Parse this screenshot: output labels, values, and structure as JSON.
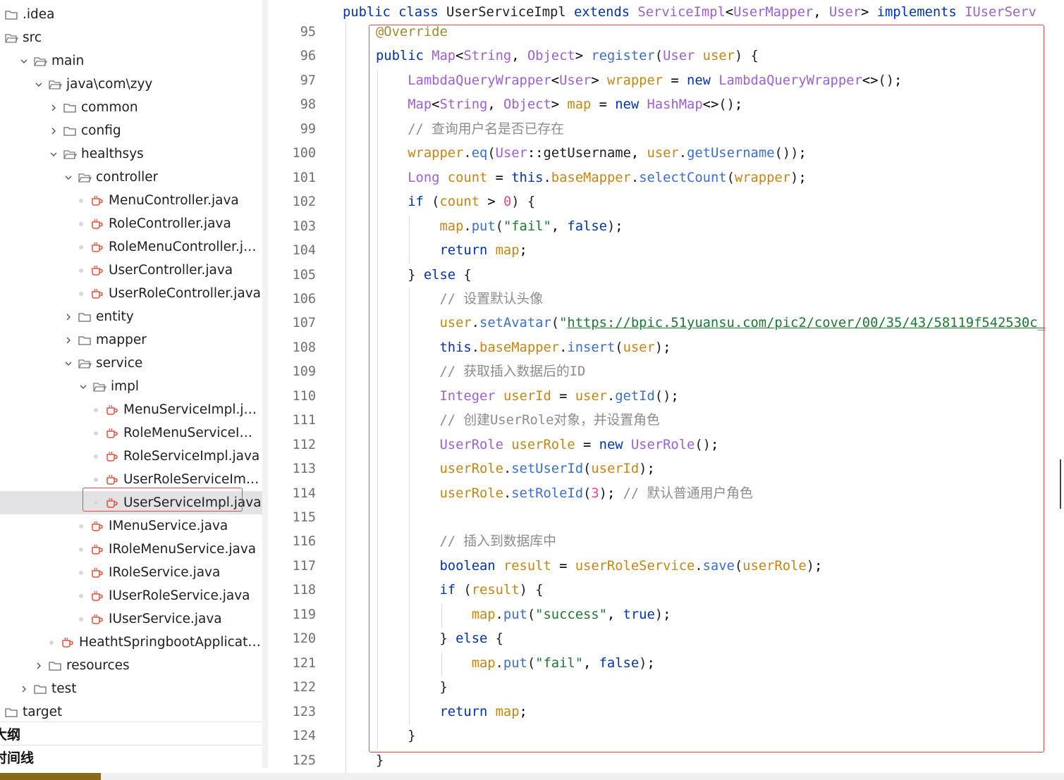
{
  "explorer": {
    "items": [
      {
        "label": ".idea",
        "type": "folder",
        "depth": 0,
        "chevron": "none"
      },
      {
        "label": "src",
        "type": "folder-open",
        "depth": 0,
        "chevron": "none"
      },
      {
        "label": "main",
        "type": "folder-open",
        "depth": 1,
        "chevron": "down"
      },
      {
        "label": "java\\com\\zyy",
        "type": "folder-open",
        "depth": 2,
        "chevron": "down"
      },
      {
        "label": "common",
        "type": "folder",
        "depth": 3,
        "chevron": "right"
      },
      {
        "label": "config",
        "type": "folder",
        "depth": 3,
        "chevron": "right"
      },
      {
        "label": "healthsys",
        "type": "folder-open",
        "depth": 3,
        "chevron": "down"
      },
      {
        "label": "controller",
        "type": "folder-open",
        "depth": 4,
        "chevron": "down"
      },
      {
        "label": "MenuController.java",
        "type": "java",
        "depth": 5
      },
      {
        "label": "RoleController.java",
        "type": "java",
        "depth": 5
      },
      {
        "label": "RoleMenuController.java",
        "type": "java",
        "depth": 5
      },
      {
        "label": "UserController.java",
        "type": "java",
        "depth": 5
      },
      {
        "label": "UserRoleController.java",
        "type": "java",
        "depth": 5
      },
      {
        "label": "entity",
        "type": "folder",
        "depth": 4,
        "chevron": "right"
      },
      {
        "label": "mapper",
        "type": "folder",
        "depth": 4,
        "chevron": "right"
      },
      {
        "label": "service",
        "type": "folder-open",
        "depth": 4,
        "chevron": "down"
      },
      {
        "label": "impl",
        "type": "folder-open",
        "depth": 5,
        "chevron": "down"
      },
      {
        "label": "MenuServiceImpl.java",
        "type": "java",
        "depth": 6
      },
      {
        "label": "RoleMenuServiceImpl.j...",
        "type": "java",
        "depth": 6
      },
      {
        "label": "RoleServiceImpl.java",
        "type": "java",
        "depth": 6
      },
      {
        "label": "UserRoleServiceImpl.java",
        "type": "java",
        "depth": 6
      },
      {
        "label": "UserServiceImpl.java",
        "type": "java",
        "depth": 6,
        "selected": true
      },
      {
        "label": "IMenuService.java",
        "type": "java",
        "depth": 5
      },
      {
        "label": "IRoleMenuService.java",
        "type": "java",
        "depth": 5
      },
      {
        "label": "IRoleService.java",
        "type": "java",
        "depth": 5
      },
      {
        "label": "IUserRoleService.java",
        "type": "java",
        "depth": 5
      },
      {
        "label": "IUserService.java",
        "type": "java",
        "depth": 5
      },
      {
        "label": "HeathtSpringbootApplication.j...",
        "type": "java",
        "depth": 3
      },
      {
        "label": "resources",
        "type": "folder",
        "depth": 2,
        "chevron": "right"
      },
      {
        "label": "test",
        "type": "folder",
        "depth": 1,
        "chevron": "right"
      },
      {
        "label": "target",
        "type": "folder",
        "depth": 0,
        "chevron": "none"
      }
    ],
    "sections": [
      "大纲",
      "时间线"
    ]
  },
  "editor": {
    "header": "public class UserServiceImpl extends ServiceImpl<UserMapper, User> implements IUserServ",
    "line_numbers": [
      "95",
      "96",
      "97",
      "98",
      "99",
      "100",
      "101",
      "102",
      "103",
      "104",
      "105",
      "106",
      "107",
      "108",
      "109",
      "110",
      "111",
      "112",
      "113",
      "114",
      "115",
      "116",
      "117",
      "118",
      "119",
      "120",
      "121",
      "122",
      "123",
      "124",
      "125"
    ],
    "lines": [
      "@Override",
      "public Map<String, Object> register(User user) {",
      "    LambdaQueryWrapper<User> wrapper = new LambdaQueryWrapper<>();",
      "    Map<String, Object> map = new HashMap<>();",
      "    // 查询用户名是否已存在",
      "    wrapper.eq(User::getUsername, user.getUsername());",
      "    Long count = this.baseMapper.selectCount(wrapper);",
      "    if (count > 0) {",
      "        map.put(\"fail\", false);",
      "        return map;",
      "    } else {",
      "        // 设置默认头像",
      "        user.setAvatar(\"https://bpic.51yuansu.com/pic2/cover/00/35/43/58119f542530c_",
      "        this.baseMapper.insert(user);",
      "        // 获取插入数据后的ID",
      "        Integer userId = user.getId();",
      "        // 创建UserRole对象，并设置角色",
      "        UserRole userRole = new UserRole();",
      "        userRole.setUserId(userId);",
      "        userRole.setRoleId(3); // 默认普通用户角色",
      "",
      "        // 插入到数据库中",
      "        boolean result = userRoleService.save(userRole);",
      "        if (result) {",
      "            map.put(\"success\", true);",
      "        } else {",
      "            map.put(\"fail\", false);",
      "        }",
      "        return map;",
      "    }",
      "}"
    ]
  },
  "colors": {
    "keyword": "#0033b3",
    "type": "#9e5fd9",
    "field": "#c78614",
    "method": "#3a6ed3",
    "string": "#1a7a2f",
    "comment": "#8c8c8c",
    "number": "#e14c8e",
    "highlight_border": "#e5484d",
    "java_icon": "#e2513a"
  }
}
